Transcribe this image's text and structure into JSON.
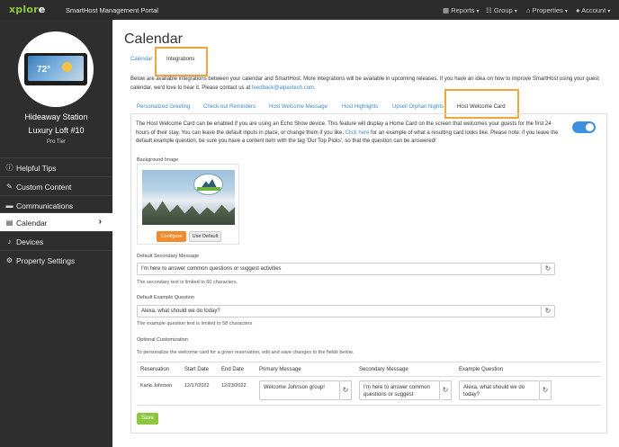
{
  "app": {
    "brand_main": "xplor",
    "brand_accent": "e",
    "portal_name": "SmartHost Management Portal",
    "nav": [
      {
        "label": "Reports"
      },
      {
        "label": "Group"
      },
      {
        "label": "Properties"
      },
      {
        "label": "Account"
      }
    ]
  },
  "sidebar": {
    "device_temp": "72°",
    "station": "Hideaway Station",
    "property": "Luxury Loft #10",
    "tier": "Pro Tier",
    "items": [
      {
        "label": "Helpful Tips",
        "icon": "info-icon"
      },
      {
        "label": "Custom Content",
        "icon": "pencil-icon"
      },
      {
        "label": "Communications",
        "icon": "chat-icon"
      },
      {
        "label": "Calendar",
        "icon": "calendar-icon",
        "active": true
      },
      {
        "label": "Devices",
        "icon": "bell-icon"
      },
      {
        "label": "Property Settings",
        "icon": "gear-icon"
      }
    ]
  },
  "main": {
    "title": "Calendar",
    "tabs": [
      {
        "label": "Calendar"
      },
      {
        "label": "Integrations",
        "active": true
      }
    ],
    "intro_pre": "Below are available integrations between your calendar and SmartHost. More integrations will be available in upcoming releases. If you have an idea on how to improve SmartHost using your guest calendar, we'd love to hear it. Please contact us at ",
    "intro_link": "feedback@alpextech.com",
    "intro_post": ".",
    "subtabs": [
      {
        "label": "Personalized Greeting"
      },
      {
        "label": "Check-out Reminders"
      },
      {
        "label": "Host Welcome Message"
      },
      {
        "label": "Host Highlights"
      },
      {
        "label": "Upsell Orphan Nights"
      },
      {
        "label": "Host Welcome Card",
        "active": true
      }
    ],
    "card": {
      "desc_pre": "The Host Welcome Card can be enabled if you are using an Echo Show device. This feature will display a Home Card on the screen that welcomes your guests for the first 24 hours of their stay. You can leave the default inputs in place, or change them if you like. ",
      "desc_link": "Click here",
      "desc_post": " for an example of what a resulting card looks like. Please note: if you leave the default example question, be sure you have a content item with the tag 'Our Top Picks', so that the question can be answered!",
      "enabled": true,
      "bg_label": "Background Image",
      "configure_label": "Configure",
      "use_default_label": "Use Default",
      "secondary_label": "Default Secondary Message",
      "secondary_value": "I'm here to answer common questions or suggest activities",
      "secondary_help": "The secondary text is limited to 60 characters.",
      "question_label": "Default Example Question",
      "question_value": "Alexa, what should we do today?",
      "question_help": "The example question text is limited to 58 characters",
      "optional_label": "Optional Customization",
      "optional_help": "To personalize the welcome card for a given reservation, edit and save changes to the fields below.",
      "table": {
        "headers": [
          "Reservation",
          "Start Date",
          "End Date",
          "Primary Message",
          "Secondary Message",
          "Example Question"
        ],
        "rows": [
          {
            "reservation": "Karla Johnson",
            "start": "12/17/2022",
            "end": "12/23/2022",
            "primary": "Welcome Johnson group!",
            "secondary": "I'm here to answer common questions or suggest",
            "question": "Alexa, what should we do today?"
          }
        ]
      },
      "save_label": "Save"
    }
  },
  "colors": {
    "accent_orange": "#f08a2c",
    "highlight": "#f2a63a",
    "link_blue": "#3a8bc9",
    "toggle_blue": "#3f8fe0",
    "save_green": "#8dc63f",
    "topbar": "#2b2b2b",
    "sidebar": "#2e2e2e"
  }
}
